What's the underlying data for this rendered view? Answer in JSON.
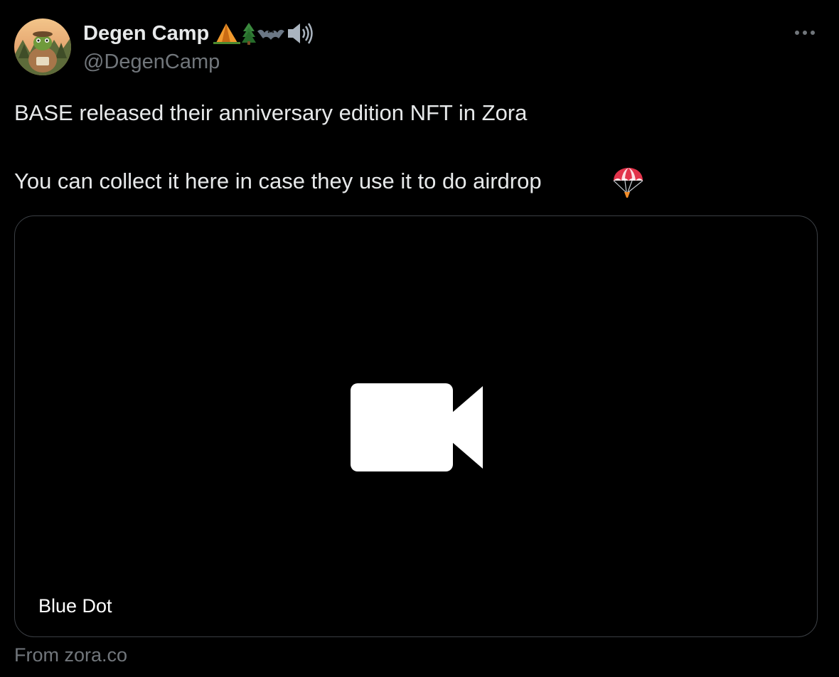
{
  "author": {
    "display_name": "Degen Camp",
    "handle": "@DegenCamp",
    "name_emojis": [
      "camping-tent",
      "evergreen-tree",
      "bat",
      "speaker-high-volume"
    ]
  },
  "tweet": {
    "line1": "BASE released their anniversary edition NFT in Zora",
    "line2": "You can collect it here in case they use it to do airdrop",
    "line2_emoji": "parachute"
  },
  "card": {
    "media_icon": "video-camera-icon",
    "title": "Blue Dot",
    "source": "From zora.co"
  },
  "colors": {
    "background": "#000000",
    "primary_text": "#e7e9ea",
    "secondary_text": "#71767b",
    "card_border": "#3b3f44"
  }
}
